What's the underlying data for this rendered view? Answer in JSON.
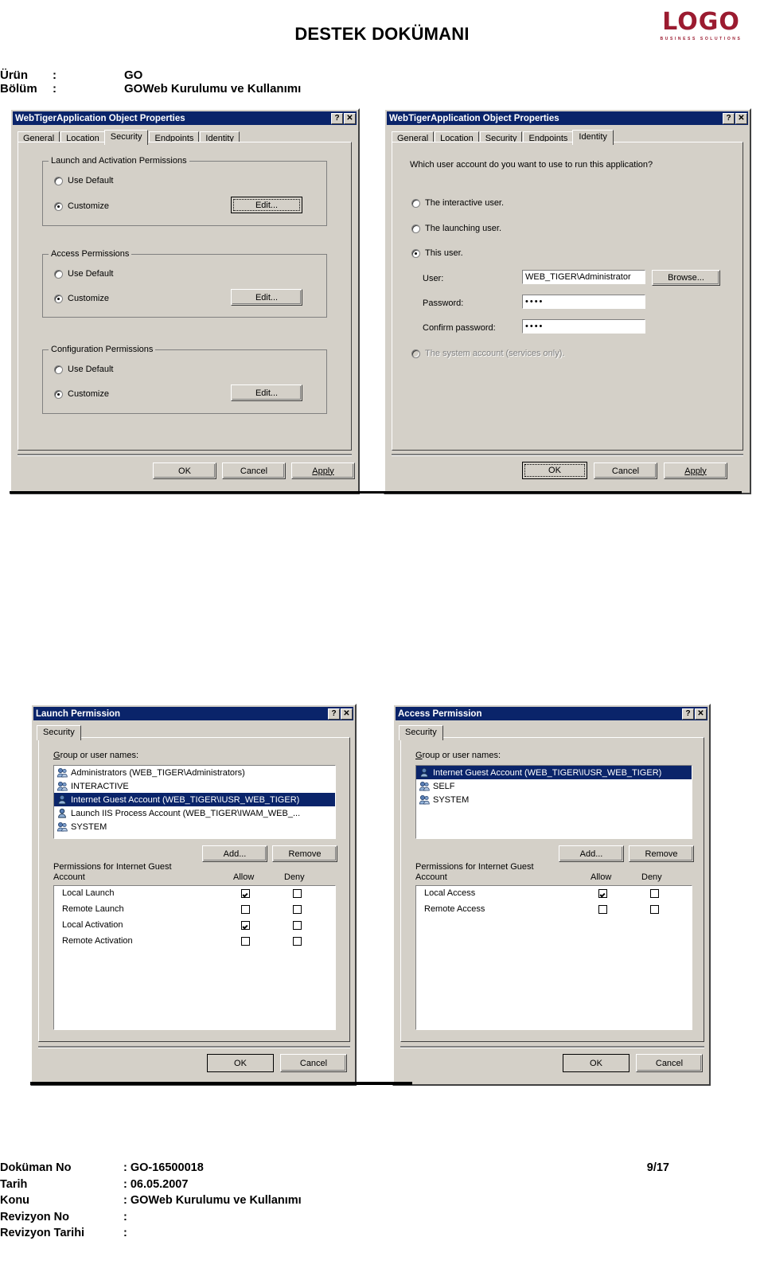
{
  "page": {
    "title": "DESTEK DOKÜMANI",
    "logo": {
      "word": "LOGO",
      "sub": "BUSINESS SOLUTIONS",
      "color": "#9b1b30"
    },
    "meta": [
      {
        "key": "Ürün",
        "colon": ":",
        "value": "GO"
      },
      {
        "key": "Bölüm",
        "colon": ":",
        "value": "GOWeb Kurulumu ve Kullanımı"
      }
    ]
  },
  "dialog_security": {
    "title": "WebTigerApplication Object Properties",
    "help_btn": "?",
    "close_btn": "✕",
    "tabs": [
      {
        "label": "General",
        "active": false
      },
      {
        "label": "Location",
        "active": false
      },
      {
        "label": "Security",
        "active": true
      },
      {
        "label": "Endpoints",
        "active": false
      },
      {
        "label": "Identity",
        "active": false
      }
    ],
    "groups": [
      {
        "label": "Launch and Activation Permissions",
        "options": [
          {
            "label": "Use Default",
            "selected": false
          },
          {
            "label": "Customize",
            "selected": true
          }
        ],
        "edit_label": "Edit...",
        "edit_focused": true
      },
      {
        "label": "Access Permissions",
        "options": [
          {
            "label": "Use Default",
            "selected": false
          },
          {
            "label": "Customize",
            "selected": true
          }
        ],
        "edit_label": "Edit...",
        "edit_focused": false
      },
      {
        "label": "Configuration Permissions",
        "options": [
          {
            "label": "Use Default",
            "selected": false
          },
          {
            "label": "Customize",
            "selected": true
          }
        ],
        "edit_label": "Edit...",
        "edit_focused": false
      }
    ],
    "buttons": {
      "ok": "OK",
      "cancel": "Cancel",
      "apply": "Apply"
    }
  },
  "dialog_identity": {
    "title": "WebTigerApplication Object Properties",
    "help_btn": "?",
    "close_btn": "✕",
    "tabs": [
      {
        "label": "General",
        "active": false
      },
      {
        "label": "Location",
        "active": false
      },
      {
        "label": "Security",
        "active": false
      },
      {
        "label": "Endpoints",
        "active": false
      },
      {
        "label": "Identity",
        "active": true
      }
    ],
    "question": "Which user account do you want to use to run this application?",
    "options": [
      {
        "label": "The interactive user.",
        "selected": false,
        "disabled": false
      },
      {
        "label": "The launching user.",
        "selected": false,
        "disabled": false
      },
      {
        "label": "This user.",
        "selected": true,
        "disabled": false
      }
    ],
    "fields": [
      {
        "label": "User:",
        "value": "WEB_TIGER\\Administrator"
      },
      {
        "label": "Password:",
        "value": "••••"
      },
      {
        "label": "Confirm password:",
        "value": "••••"
      }
    ],
    "browse_label": "Browse...",
    "system_account": {
      "label": "The system account (services only).",
      "selected": false,
      "disabled": true
    },
    "buttons": {
      "ok": "OK",
      "cancel": "Cancel",
      "apply": "Apply"
    },
    "ok_is_default": true
  },
  "dialog_launch_permission": {
    "title": "Launch Permission",
    "help_btn": "?",
    "close_btn": "✕",
    "tabs": [
      {
        "label": "Security",
        "active": true
      }
    ],
    "list_label": "Group or user names:",
    "list_items": [
      {
        "text": "Administrators (WEB_TIGER\\Administrators)",
        "selected": false
      },
      {
        "text": "INTERACTIVE",
        "selected": false
      },
      {
        "text": "Internet Guest Account (WEB_TIGER\\IUSR_WEB_TIGER)",
        "selected": true
      },
      {
        "text": "Launch IIS Process Account (WEB_TIGER\\IWAM_WEB_...",
        "selected": false
      },
      {
        "text": "SYSTEM",
        "selected": false
      }
    ],
    "add_label": "Add...",
    "remove_label": "Remove",
    "perm_label_line1": "Permissions for Internet Guest",
    "perm_label_line2": "Account",
    "col_allow": "Allow",
    "col_deny": "Deny",
    "permissions": [
      {
        "name": "Local Launch",
        "allow": true,
        "deny": false
      },
      {
        "name": "Remote Launch",
        "allow": false,
        "deny": false
      },
      {
        "name": "Local Activation",
        "allow": true,
        "deny": false
      },
      {
        "name": "Remote Activation",
        "allow": false,
        "deny": false
      }
    ],
    "buttons": {
      "ok": "OK",
      "cancel": "Cancel"
    }
  },
  "dialog_access_permission": {
    "title": "Access Permission",
    "help_btn": "?",
    "close_btn": "✕",
    "tabs": [
      {
        "label": "Security",
        "active": true
      }
    ],
    "list_label": "Group or user names:",
    "list_items": [
      {
        "text": "Internet Guest Account (WEB_TIGER\\IUSR_WEB_TIGER)",
        "selected": true
      },
      {
        "text": "SELF",
        "selected": false
      },
      {
        "text": "SYSTEM",
        "selected": false
      }
    ],
    "add_label": "Add...",
    "remove_label": "Remove",
    "perm_label_line1": "Permissions for Internet Guest",
    "perm_label_line2": "Account",
    "col_allow": "Allow",
    "col_deny": "Deny",
    "permissions": [
      {
        "name": "Local Access",
        "allow": true,
        "deny": false
      },
      {
        "name": "Remote Access",
        "allow": false,
        "deny": false
      }
    ],
    "buttons": {
      "ok": "OK",
      "cancel": "Cancel"
    }
  },
  "footer": {
    "rows": [
      {
        "key": "Doküman No",
        "value": ": GO-16500018"
      },
      {
        "key": "Tarih",
        "value": ": 06.05.2007"
      },
      {
        "key": "Konu",
        "value": ": GOWeb Kurulumu ve Kullanımı"
      },
      {
        "key": "Revizyon No",
        "value": ":"
      },
      {
        "key": "Revizyon Tarihi",
        "value": ":"
      }
    ],
    "page": "9/17"
  }
}
